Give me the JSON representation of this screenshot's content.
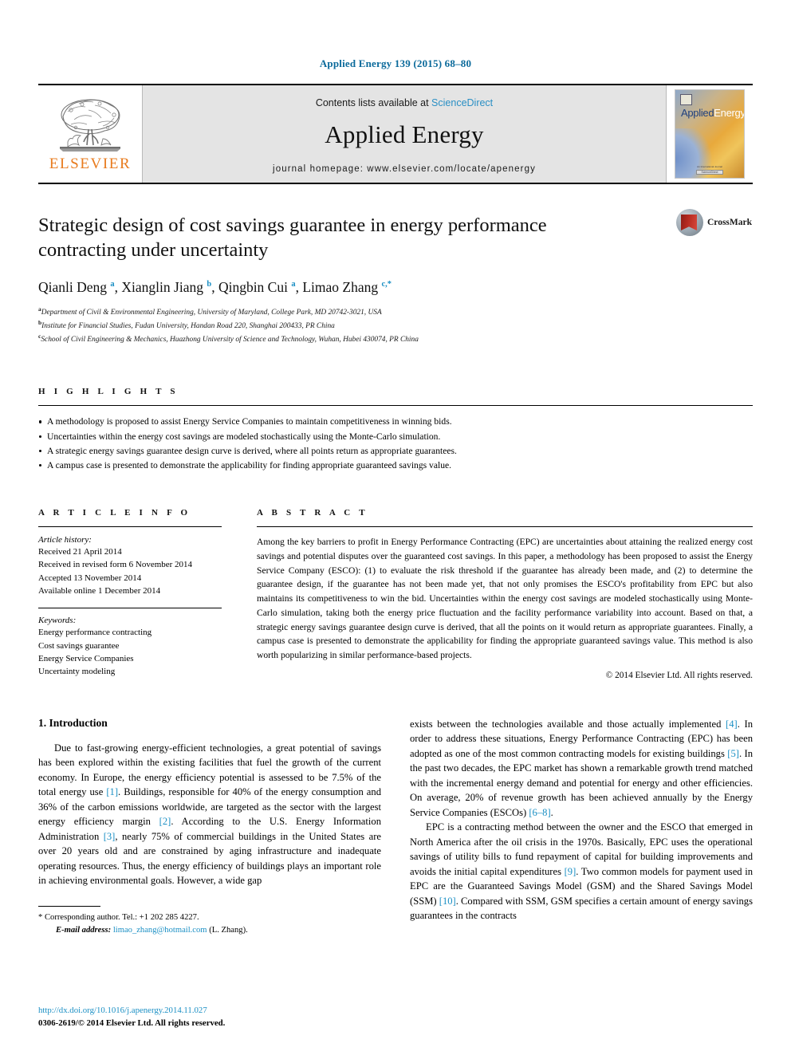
{
  "running_head": "Applied Energy 139 (2015) 68–80",
  "masthead": {
    "publisher_name": "ELSEVIER",
    "contents_prefix": "Contents lists available at ",
    "contents_link": "ScienceDirect",
    "journal_name": "Applied Energy",
    "homepage": "journal homepage: www.elsevier.com/locate/apenergy",
    "cover": {
      "title_part1": "Applied",
      "title_part2": "Energy",
      "foot_text": "An International Journal",
      "foot_badge": "ScienceDirect"
    }
  },
  "article": {
    "title": "Strategic design of cost savings guarantee in energy performance contracting under uncertainty",
    "crossmark_label": "CrossMark",
    "authors_html": "Qianli Deng <sup>a</sup>, Xianglin Jiang <sup>b</sup>, Qingbin Cui <sup>a</sup>, Limao Zhang <sup>c,</sup><sup>*</sup>",
    "affiliations": [
      {
        "marker": "a",
        "text": "Department of Civil & Environmental Engineering, University of Maryland, College Park, MD 20742-3021, USA"
      },
      {
        "marker": "b",
        "text": "Institute for Financial Studies, Fudan University, Handan Road 220, Shanghai 200433, PR China"
      },
      {
        "marker": "c",
        "text": "School of Civil Engineering & Mechanics, Huazhong University of Science and Technology, Wuhan, Hubei 430074, PR China"
      }
    ]
  },
  "highlights": {
    "label": "H I G H L I G H T S",
    "items": [
      "A methodology is proposed to assist Energy Service Companies to maintain competitiveness in winning bids.",
      "Uncertainties within the energy cost savings are modeled stochastically using the Monte-Carlo simulation.",
      "A strategic energy savings guarantee design curve is derived, where all points return as appropriate guarantees.",
      "A campus case is presented to demonstrate the applicability for finding appropriate guaranteed savings value."
    ]
  },
  "article_info": {
    "label": "A R T I C L E    I N F O",
    "history_label": "Article history:",
    "history": [
      "Received 21 April 2014",
      "Received in revised form 6 November 2014",
      "Accepted 13 November 2014",
      "Available online 1 December 2014"
    ],
    "keywords_label": "Keywords:",
    "keywords": [
      "Energy performance contracting",
      "Cost savings guarantee",
      "Energy Service Companies",
      "Uncertainty modeling"
    ]
  },
  "abstract": {
    "label": "A B S T R A C T",
    "text": "Among the key barriers to profit in Energy Performance Contracting (EPC) are uncertainties about attaining the realized energy cost savings and potential disputes over the guaranteed cost savings. In this paper, a methodology has been proposed to assist the Energy Service Company (ESCO): (1) to evaluate the risk threshold if the guarantee has already been made, and (2) to determine the guarantee design, if the guarantee has not been made yet, that not only promises the ESCO's profitability from EPC but also maintains its competitiveness to win the bid. Uncertainties within the energy cost savings are modeled stochastically using Monte-Carlo simulation, taking both the energy price fluctuation and the facility performance variability into account. Based on that, a strategic energy savings guarantee design curve is derived, that all the points on it would return as appropriate guarantees. Finally, a campus case is presented to demonstrate the applicability for finding the appropriate guaranteed savings value. This method is also worth popularizing in similar performance-based projects.",
    "copyright": "© 2014 Elsevier Ltd. All rights reserved."
  },
  "body": {
    "section_heading": "1. Introduction",
    "left_paragraph_1_a": "Due to fast-growing energy-efficient technologies, a great potential of savings has been explored within the existing facilities that fuel the growth of the current economy. In Europe, the energy efficiency potential is assessed to be 7.5% of the total energy use ",
    "ref1": "[1]",
    "left_paragraph_1_b": ". Buildings, responsible for 40% of the energy consumption and 36% of the carbon emissions worldwide, are targeted as the sector with the largest energy efficiency margin ",
    "ref2": "[2]",
    "left_paragraph_1_c": ". According to the U.S. Energy Information Administration ",
    "ref3": "[3]",
    "left_paragraph_1_d": ", nearly 75% of commercial buildings in the United States are over 20 years old and are constrained by aging infrastructure and inadequate operating resources. Thus, the energy efficiency of buildings plays an important role in achieving environmental goals. However, a wide gap",
    "right_paragraph_1_a": "exists between the technologies available and those actually implemented ",
    "ref4": "[4]",
    "right_paragraph_1_b": ". In order to address these situations, Energy Performance Contracting (EPC) has been adopted as one of the most common contracting models for existing buildings ",
    "ref5": "[5]",
    "right_paragraph_1_c": ". In the past two decades, the EPC market has shown a remarkable growth trend matched with the incremental energy demand and potential for energy and other efficiencies. On average, 20% of revenue growth has been achieved annually by the Energy Service Companies (ESCOs) ",
    "ref68": "[6–8]",
    "right_paragraph_1_d": ".",
    "right_paragraph_2_a": "EPC is a contracting method between the owner and the ESCO that emerged in North America after the oil crisis in the 1970s. Basically, EPC uses the operational savings of utility bills to fund repayment of capital for building improvements and avoids the initial capital expenditures ",
    "ref9": "[9]",
    "right_paragraph_2_b": ". Two common models for payment used in EPC are the Guaranteed Savings Model (GSM) and the Shared Savings Model (SSM) ",
    "ref10": "[10]",
    "right_paragraph_2_c": ". Compared with SSM, GSM specifies a certain amount of energy savings guarantees in the contracts"
  },
  "footnote": {
    "corresponding_marker": "*",
    "corresponding_text": "Corresponding author. Tel.: +1 202 285 4227.",
    "email_label": "E-mail address:",
    "email": "limao_zhang@hotmail.com",
    "email_owner": "(L. Zhang)."
  },
  "page_footer": {
    "doi": "http://dx.doi.org/10.1016/j.apenergy.2014.11.027",
    "issn_line": "0306-2619/© 2014 Elsevier Ltd. All rights reserved."
  },
  "colors": {
    "link": "#1a8fc4",
    "running_head": "#0b6a9b",
    "elsevier_orange": "#E87B1E"
  }
}
